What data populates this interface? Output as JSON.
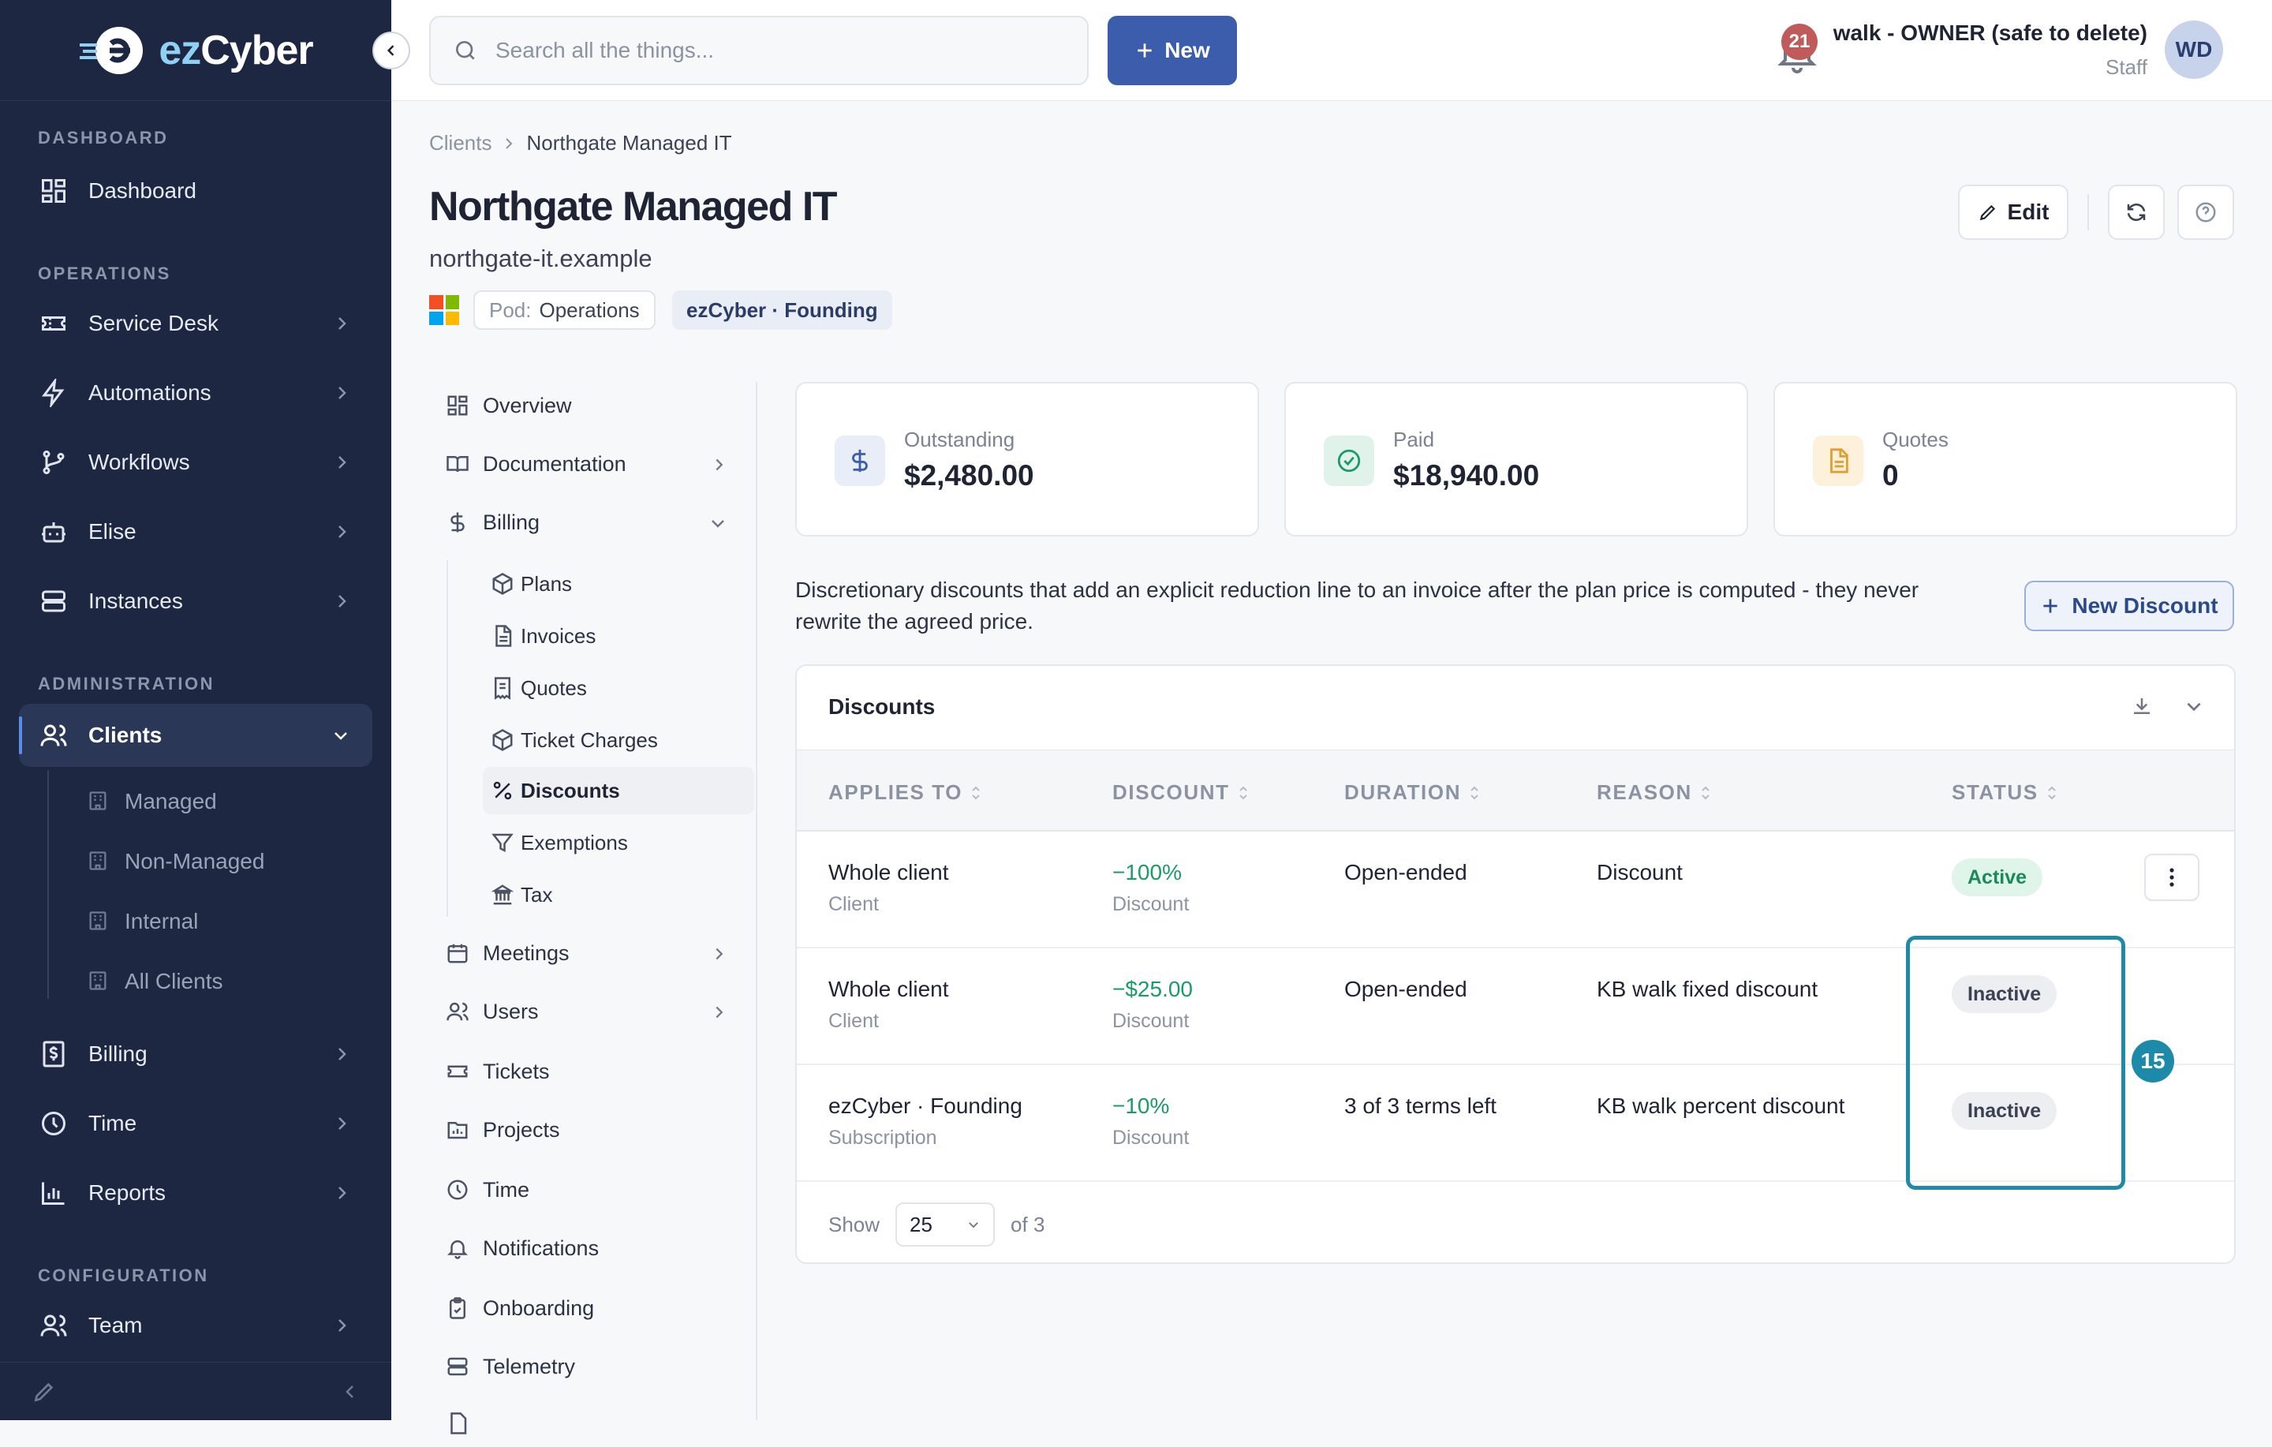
{
  "app": {
    "brand_prefix": "ez",
    "brand_suffix": "Cyber"
  },
  "sidebar": {
    "sections": {
      "dashboard": "DASHBOARD",
      "operations": "OPERATIONS",
      "administration": "ADMINISTRATION",
      "configuration": "CONFIGURATION"
    },
    "items": {
      "dashboard": "Dashboard",
      "service_desk": "Service Desk",
      "automations": "Automations",
      "workflows": "Workflows",
      "elise": "Elise",
      "instances": "Instances",
      "clients": "Clients",
      "billing": "Billing",
      "time": "Time",
      "reports": "Reports",
      "team": "Team"
    },
    "client_sub": [
      "Managed",
      "Non-Managed",
      "Internal",
      "All Clients"
    ]
  },
  "topbar": {
    "search_placeholder": "Search all the things...",
    "new_label": "New",
    "notification_count": "21",
    "user_name": "walk - OWNER (safe to delete)",
    "user_role": "Staff",
    "avatar_initials": "WD"
  },
  "breadcrumb": {
    "root": "Clients",
    "current": "Northgate Managed IT"
  },
  "client": {
    "name": "Northgate Managed IT",
    "domain": "northgate-it.example",
    "pod_label": "Pod:",
    "pod_value": "Operations",
    "plan": "ezCyber · Founding",
    "edit_label": "Edit"
  },
  "subnav": {
    "overview": "Overview",
    "documentation": "Documentation",
    "billing": "Billing",
    "billing_items": [
      "Plans",
      "Invoices",
      "Quotes",
      "Ticket Charges",
      "Discounts",
      "Exemptions",
      "Tax"
    ],
    "meetings": "Meetings",
    "users": "Users",
    "tickets": "Tickets",
    "projects": "Projects",
    "time": "Time",
    "notifications": "Notifications",
    "onboarding": "Onboarding",
    "telemetry": "Telemetry"
  },
  "stats": {
    "outstanding": {
      "label": "Outstanding",
      "value": "$2,480.00"
    },
    "paid": {
      "label": "Paid",
      "value": "$18,940.00"
    },
    "quotes": {
      "label": "Quotes",
      "value": "0"
    }
  },
  "description": "Discretionary discounts that add an explicit reduction line to an invoice after the plan price is computed - they never rewrite the agreed price.",
  "new_discount_label": "New Discount",
  "table": {
    "title": "Discounts",
    "columns": [
      "APPLIES TO",
      "DISCOUNT",
      "DURATION",
      "REASON",
      "STATUS"
    ],
    "rows": [
      {
        "applies": "Whole client",
        "applies_sub": "Client",
        "discount": "−100%",
        "discount_sub": "Discount",
        "duration": "Open-ended",
        "reason": "Discount",
        "status": "Active"
      },
      {
        "applies": "Whole client",
        "applies_sub": "Client",
        "discount": "−$25.00",
        "discount_sub": "Discount",
        "duration": "Open-ended",
        "reason": "KB walk fixed discount",
        "status": "Inactive"
      },
      {
        "applies": "ezCyber · Founding",
        "applies_sub": "Subscription",
        "discount": "−10%",
        "discount_sub": "Discount",
        "duration": "3 of 3 terms left",
        "reason": "KB walk percent discount",
        "status": "Inactive"
      }
    ],
    "show_label": "Show",
    "page_size": "25",
    "total_label": "of 3"
  },
  "annotation": {
    "marker": "15"
  },
  "colors": {
    "sidebar_bg": "#1d2742",
    "accent": "#3b5dab",
    "success": "#1b9a6a",
    "highlight": "#1c8aa8"
  }
}
